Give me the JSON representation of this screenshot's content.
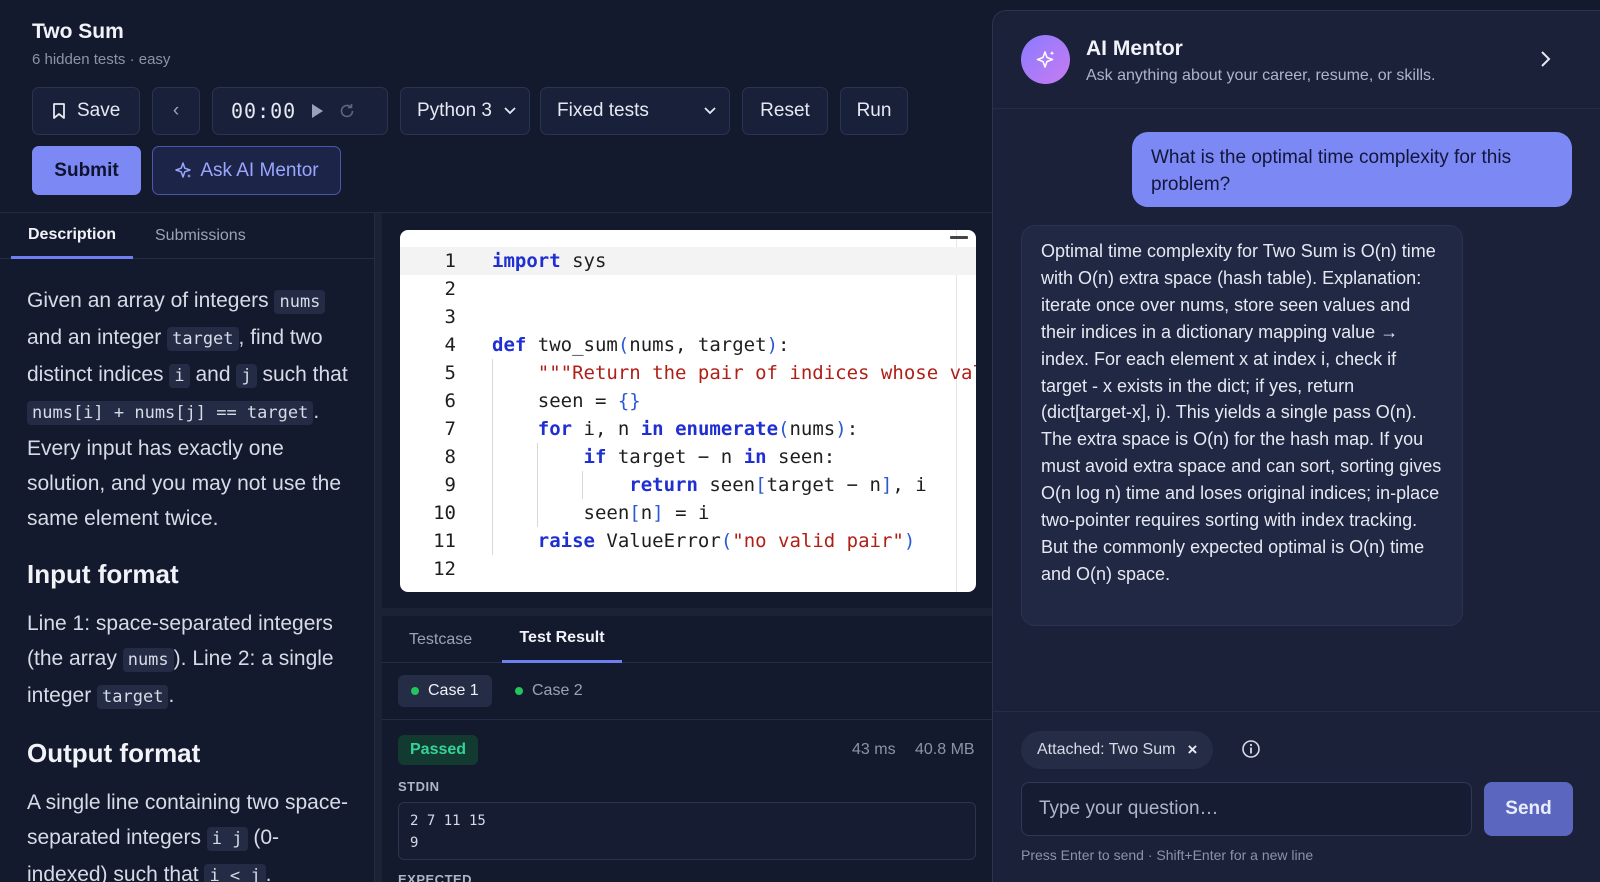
{
  "problem": {
    "title": "Two Sum",
    "meta": "6 hidden tests · easy"
  },
  "toolbar": {
    "save_label": "Save",
    "prev_icon": "‹",
    "timer": "00:00",
    "language": "Python 3",
    "test_mode": "Fixed tests",
    "reset_label": "Reset",
    "run_label": "Run",
    "submit_label": "Submit",
    "ask_mentor_label": "Ask AI Mentor"
  },
  "left_tabs": {
    "description": "Description",
    "submissions": "Submissions"
  },
  "description": {
    "p1": [
      {
        "t": "Given an array of integers "
      },
      {
        "c": "nums"
      },
      {
        "t": " and an integer "
      },
      {
        "c": "target"
      },
      {
        "t": ", find two distinct indices "
      },
      {
        "c": "i"
      },
      {
        "t": " and "
      },
      {
        "c": "j"
      },
      {
        "t": " such that "
      },
      {
        "c": "nums[i] + nums[j] == target"
      },
      {
        "t": ". Every input has exactly one solution, and you may not use the same element twice."
      }
    ],
    "input_heading": "Input format",
    "p2": [
      {
        "t": "Line 1: space-separated integers (the array "
      },
      {
        "c": "nums"
      },
      {
        "t": "). Line 2: a single integer "
      },
      {
        "c": "target"
      },
      {
        "t": "."
      }
    ],
    "output_heading": "Output format",
    "p3": [
      {
        "t": "A single line containing two space-separated integers "
      },
      {
        "c": "i j"
      },
      {
        "t": " (0-indexed) such that "
      },
      {
        "c": "i < j"
      },
      {
        "t": "."
      }
    ]
  },
  "editor": {
    "lines": [
      {
        "n": "1",
        "tokens": [
          [
            "kw",
            "import"
          ],
          [
            "p",
            " sys"
          ]
        ]
      },
      {
        "n": "2",
        "tokens": []
      },
      {
        "n": "3",
        "tokens": []
      },
      {
        "n": "4",
        "tokens": [
          [
            "kw",
            "def"
          ],
          [
            "p",
            " two_sum"
          ],
          [
            "br",
            "("
          ],
          [
            "p",
            "nums, target"
          ],
          [
            "br",
            ")"
          ],
          [
            "p",
            ":"
          ]
        ]
      },
      {
        "n": "5",
        "tokens": [
          [
            "p",
            "    "
          ],
          [
            "str",
            "\"\"\"Return the pair of indices whose values sum to target.\"\"\""
          ]
        ]
      },
      {
        "n": "6",
        "tokens": [
          [
            "p",
            "    seen = "
          ],
          [
            "br",
            "{}"
          ]
        ]
      },
      {
        "n": "7",
        "tokens": [
          [
            "p",
            "    "
          ],
          [
            "kw",
            "for"
          ],
          [
            "p",
            " i, n "
          ],
          [
            "kw",
            "in"
          ],
          [
            "p",
            " "
          ],
          [
            "kw",
            "enumerate"
          ],
          [
            "br",
            "("
          ],
          [
            "p",
            "nums"
          ],
          [
            "br",
            ")"
          ],
          [
            "p",
            ":"
          ]
        ]
      },
      {
        "n": "8",
        "tokens": [
          [
            "p",
            "        "
          ],
          [
            "kw",
            "if"
          ],
          [
            "p",
            " target − n "
          ],
          [
            "kw",
            "in"
          ],
          [
            "p",
            " seen:"
          ]
        ]
      },
      {
        "n": "9",
        "tokens": [
          [
            "p",
            "            "
          ],
          [
            "kw",
            "return"
          ],
          [
            "p",
            " seen"
          ],
          [
            "br",
            "["
          ],
          [
            "p",
            "target − n"
          ],
          [
            "br",
            "]"
          ],
          [
            "p",
            ", i"
          ]
        ]
      },
      {
        "n": "10",
        "tokens": [
          [
            "p",
            "        seen"
          ],
          [
            "br",
            "["
          ],
          [
            "p",
            "n"
          ],
          [
            "br",
            "]"
          ],
          [
            "p",
            " = i"
          ]
        ]
      },
      {
        "n": "11",
        "tokens": [
          [
            "p",
            "    "
          ],
          [
            "kw",
            "raise"
          ],
          [
            "p",
            " ValueError"
          ],
          [
            "br",
            "("
          ],
          [
            "str",
            "\"no valid pair\""
          ],
          [
            "br",
            ")"
          ]
        ]
      },
      {
        "n": "12",
        "tokens": []
      }
    ]
  },
  "result_tabs": {
    "testcase": "Testcase",
    "test_result": "Test Result"
  },
  "result": {
    "case1": "Case 1",
    "case2": "Case 2",
    "status": "Passed",
    "time": "43 ms",
    "memory": "40.8 MB",
    "stdin_label": "STDIN",
    "stdin": "2 7 11 15\n9",
    "expected_label": "EXPECTED"
  },
  "mentor": {
    "title": "AI Mentor",
    "subtitle": "Ask anything about your career, resume, or skills.",
    "user_message": "What is the optimal time complexity for this problem?",
    "ai_message": "Optimal time complexity for Two Sum is O(n) time with O(n) extra space (hash table). Explanation: iterate once over nums, store seen values and their indices in a dictionary mapping value → index. For each element x at index i, check if target - x exists in the dict; if yes, return (dict[target-x], i). This yields a single pass O(n). The extra space is O(n) for the hash map. If you must avoid extra space and can sort, sorting gives O(n log n) time and loses original indices; in-place two-pointer requires sorting with index tracking. But the commonly expected optimal is O(n) time and O(n) space.",
    "attached_chip": "Attached: Two Sum",
    "chip_close": "×",
    "input_placeholder": "Type your question…",
    "send_label": "Send",
    "hint": "Press Enter to send · Shift+Enter for a new line"
  },
  "colors": {
    "background": "#141a2e",
    "accent": "#7c89f4",
    "success": "#34d399"
  }
}
